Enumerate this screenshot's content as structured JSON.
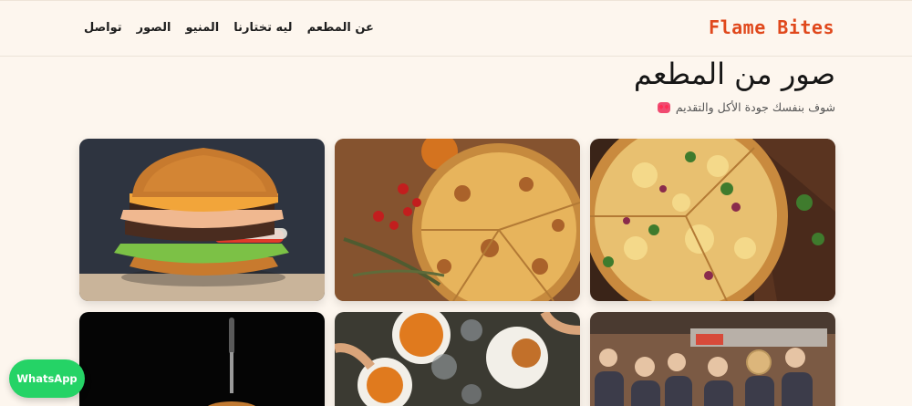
{
  "brand": "Flame Bites",
  "nav": [
    "عن المطعم",
    "ليه تختارنا",
    "المنيو",
    "الصور",
    "تواصل"
  ],
  "gallery": {
    "title": "صور من المطعم",
    "subtitle": "شوف بنفسك جودة الأكل والتقديم",
    "subtitle_emoji": "heart-eyes-emoji"
  },
  "whatsapp": "WhatsApp",
  "colors": {
    "brand": "#e0481c",
    "background": "#fdf6ee",
    "whatsapp": "#25d366"
  }
}
